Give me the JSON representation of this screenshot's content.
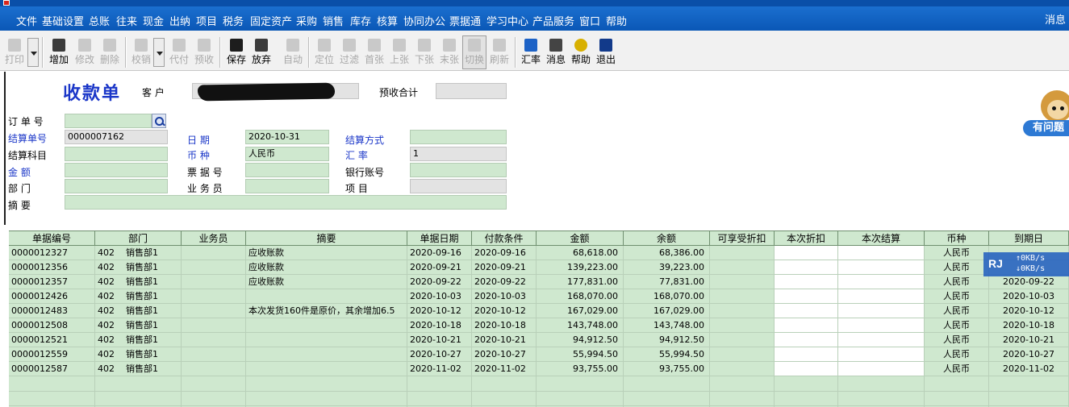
{
  "menu": {
    "items": [
      "文件",
      "基础设置",
      "总账",
      "往来",
      "现金",
      "出纳",
      "项目",
      "税务",
      "固定资产",
      "采购",
      "销售",
      "库存",
      "核算",
      "协同办公",
      "票据通",
      "学习中心",
      "产品服务",
      "窗口",
      "帮助"
    ],
    "right_label": "消息"
  },
  "toolbar": {
    "print": "打印",
    "add": "增加",
    "edit": "修改",
    "delete": "删除",
    "verify": "校销",
    "proxy_pay": "代付",
    "prepay": "预收",
    "save": "保存",
    "discard": "放弃",
    "auto": "自动",
    "locate": "定位",
    "filter": "过滤",
    "first": "首张",
    "prev": "上张",
    "next": "下张",
    "last": "末张",
    "switch": "切换",
    "refresh": "刷新",
    "rate": "汇率",
    "message": "消息",
    "help": "帮助",
    "exit": "退出"
  },
  "form": {
    "title": "收款单",
    "customer_label": "客  户",
    "prepaid_total_label": "预收合计",
    "order_no_label": "订 单 号",
    "settle_no_label": "结算单号",
    "settle_no": "0000007162",
    "date_label": "日    期",
    "date": "2020-10-31",
    "settle_method_label": "结算方式",
    "settle_subject_label": "结算科目",
    "currency_label": "币    种",
    "currency": "人民币",
    "rate_label": "汇    率",
    "rate": "1",
    "amount_label": "金    额",
    "bill_no_label": "票 据 号",
    "bank_account_label": "银行账号",
    "dept_label": "部    门",
    "salesman_label": "业 务 员",
    "project_label": "项    目",
    "summary_label": "摘    要"
  },
  "help_pill": "有问题",
  "grid": {
    "columns": [
      "单据编号",
      "部门",
      "业务员",
      "摘要",
      "单据日期",
      "付款条件",
      "金额",
      "余额",
      "可享受折扣",
      "本次折扣",
      "本次结算",
      "币种",
      "到期日"
    ],
    "rows": [
      {
        "no": "0000012327",
        "dept_code": "402",
        "dept": "销售部1",
        "salesman": "",
        "summary": "应收账款",
        "date": "2020-09-16",
        "terms": "2020-09-16",
        "amount": "68,618.00",
        "balance": "68,386.00",
        "currency": "人民币",
        "due": ""
      },
      {
        "no": "0000012356",
        "dept_code": "402",
        "dept": "销售部1",
        "salesman": "",
        "summary": "应收账款",
        "date": "2020-09-21",
        "terms": "2020-09-21",
        "amount": "139,223.00",
        "balance": "39,223.00",
        "currency": "人民币",
        "due": ""
      },
      {
        "no": "0000012357",
        "dept_code": "402",
        "dept": "销售部1",
        "salesman": "",
        "summary": "应收账款",
        "date": "2020-09-22",
        "terms": "2020-09-22",
        "amount": "177,831.00",
        "balance": "77,831.00",
        "currency": "人民币",
        "due": "2020-09-22"
      },
      {
        "no": "0000012426",
        "dept_code": "402",
        "dept": "销售部1",
        "salesman": "",
        "summary": "",
        "date": "2020-10-03",
        "terms": "2020-10-03",
        "amount": "168,070.00",
        "balance": "168,070.00",
        "currency": "人民币",
        "due": "2020-10-03"
      },
      {
        "no": "0000012483",
        "dept_code": "402",
        "dept": "销售部1",
        "salesman": "",
        "summary": "本次发货160件是原价，其余增加6.5",
        "date": "2020-10-12",
        "terms": "2020-10-12",
        "amount": "167,029.00",
        "balance": "167,029.00",
        "currency": "人民币",
        "due": "2020-10-12"
      },
      {
        "no": "0000012508",
        "dept_code": "402",
        "dept": "销售部1",
        "salesman": "",
        "summary": "",
        "date": "2020-10-18",
        "terms": "2020-10-18",
        "amount": "143,748.00",
        "balance": "143,748.00",
        "currency": "人民币",
        "due": "2020-10-18"
      },
      {
        "no": "0000012521",
        "dept_code": "402",
        "dept": "销售部1",
        "salesman": "",
        "summary": "",
        "date": "2020-10-21",
        "terms": "2020-10-21",
        "amount": "94,912.50",
        "balance": "94,912.50",
        "currency": "人民币",
        "due": "2020-10-21"
      },
      {
        "no": "0000012559",
        "dept_code": "402",
        "dept": "销售部1",
        "salesman": "",
        "summary": "",
        "date": "2020-10-27",
        "terms": "2020-10-27",
        "amount": "55,994.50",
        "balance": "55,994.50",
        "currency": "人民币",
        "due": "2020-10-27"
      },
      {
        "no": "0000012587",
        "dept_code": "402",
        "dept": "销售部1",
        "salesman": "",
        "summary": "",
        "date": "2020-11-02",
        "terms": "2020-11-02",
        "amount": "93,755.00",
        "balance": "93,755.00",
        "currency": "人民币",
        "due": "2020-11-02"
      }
    ]
  },
  "speed_widget": {
    "logo": "RJ",
    "upload": "↑0KB/s",
    "download": "↓0KB/s"
  }
}
